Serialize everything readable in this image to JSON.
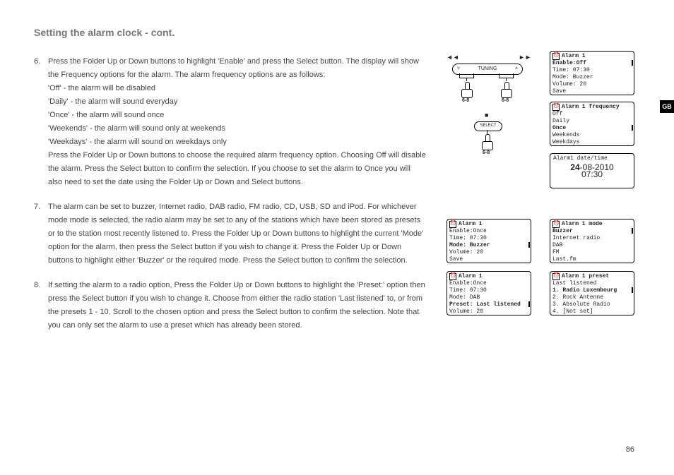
{
  "heading": "Setting the alarm clock - cont.",
  "gb": "GB",
  "pageNumber": "86",
  "steps": [
    {
      "num": "6.",
      "text": "Press the Folder Up or Down buttons to highlight 'Enable' and press the Select button. The display will show the Frequency options for the alarm. The alarm frequency options are as follows:\n'Off' - the alarm will be disabled\n'Daily' - the alarm will sound everyday\n'Once' - the alarm will sound once\n'Weekends' - the alarm will sound only at weekends\n'Weekdays' - the alarm will sound on weekdays only\nPress the Folder Up or Down buttons to choose the required alarm frequency option. Choosing Off will disable the alarm. Press the Select button to confirm the selection. If you choose to set the alarm to Once you will also need to set the date using the Folder Up or Down and Select buttons."
    },
    {
      "num": "7.",
      "text": "The alarm can be set to buzzer, Internet radio, DAB radio, FM radio, CD, USB, SD and iPod. For whichever mode mode is selected, the radio alarm may be set to any of the stations which have been stored as presets or to the station most recently listened to. Press the Folder Up or Down buttons to highlight the current 'Mode' option for the alarm, then press the Select button if you wish to change it. Press the Folder Up or Down buttons to highlight either 'Buzzer' or the required mode. Press the Select button to confirm the selection."
    },
    {
      "num": "8.",
      "text": "If setting the alarm to a radio option, Press the Folder Up or Down buttons to highlight the 'Preset:' option then press the Select button if you wish to change it. Choose from either the radio station 'Last listened' to, or from the presets 1 - 10. Scroll to the chosen option and press the Select button to confirm the selection. Note that you can only set the alarm to use a preset which has already been stored."
    }
  ],
  "diagram": {
    "prev": "◄◄",
    "next": "►►",
    "stop": "■",
    "tuning_down": "˅",
    "tuning_up": "˄",
    "tuning": "TUNING",
    "select": "SELECT",
    "step": "6-8"
  },
  "screens": {
    "s1": {
      "title": "Alarm 1",
      "l1": "Enable:Off",
      "l2": "Time: 07:30",
      "l3": "Mode: Buzzer",
      "l4": "Volume: 20",
      "l5": "Save"
    },
    "s2": {
      "title": "Alarm 1 frequency",
      "l1": "Off",
      "l2": "Daily",
      "l3": "Once",
      "l4": "Weekends",
      "l5": "Weekdays"
    },
    "s3": {
      "title": "Alarm1 date/time",
      "date_bold": "24",
      "date_rest": "-08-2010",
      "time": "07:30"
    },
    "s4": {
      "title": "Alarm 1",
      "l1": "Enable:Once",
      "l2": "Time: 07:30",
      "l3": "Mode: Buzzer",
      "l4": "Volume: 20",
      "l5": "Save"
    },
    "s5": {
      "title": "Alarm 1 mode",
      "l1": "Buzzer",
      "l2": "Internet radio",
      "l3": "DAB",
      "l4": "FM",
      "l5": "Last.fm"
    },
    "s6": {
      "title": "Alarm 1",
      "l1": "Enable:Once",
      "l2": "Time: 07:30",
      "l3": "Mode: DAB",
      "l4": "Preset: Last listened",
      "l5": "Volume: 20"
    },
    "s7": {
      "title": "Alarm 1 preset",
      "l1": "Last listened",
      "l2": "1. Radio Luxembourg",
      "l3": "2. Rock Antenne",
      "l4": "3. Absolute Radio",
      "l5": "4. [Not set]"
    }
  }
}
